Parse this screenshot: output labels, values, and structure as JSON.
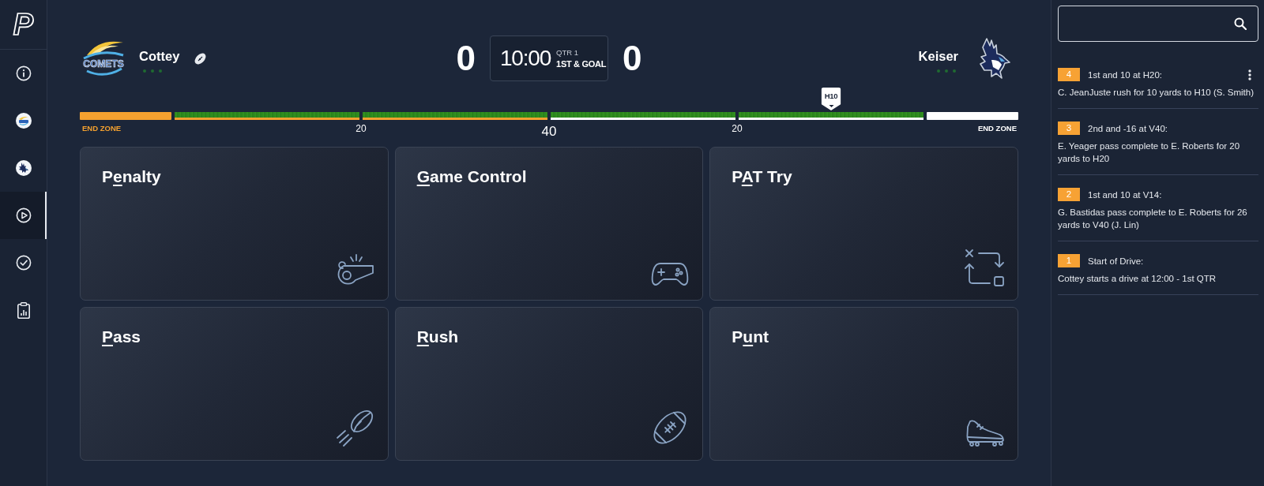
{
  "brand": {
    "logo": "P"
  },
  "sidebar": {
    "items": [
      {
        "selected": false
      },
      {
        "selected": false
      },
      {
        "selected": false
      },
      {
        "selected": true
      },
      {
        "selected": false
      },
      {
        "selected": false
      }
    ]
  },
  "scoreboard": {
    "home": {
      "name": "Cottey",
      "logo_text": "COMETS",
      "possession": true,
      "score": "0",
      "timeouts": [
        {
          "used": false
        },
        {
          "used": false
        },
        {
          "used": false
        }
      ]
    },
    "clock": {
      "time": "10:00",
      "period": "QTR 1",
      "down": "1ST & GOAL"
    },
    "away": {
      "name": "Keiser",
      "possession": false,
      "score": "0",
      "timeouts": [
        {
          "used": false
        },
        {
          "used": false
        },
        {
          "used": false
        }
      ]
    }
  },
  "field": {
    "segments": [
      {
        "kind": "end_zone",
        "color": "#f5a12f",
        "label": "END ZONE"
      },
      {
        "kind": "field",
        "color": "#f5a12f",
        "line_label": {
          "text": "20",
          "major": false
        }
      },
      {
        "kind": "field",
        "color": "#f5a12f",
        "line_label": {
          "text": "40",
          "major": true
        }
      },
      {
        "kind": "field",
        "color": "#ffffff",
        "line_label": {
          "text": "20",
          "major": false
        }
      },
      {
        "kind": "field",
        "color": "#ffffff",
        "marker": "H10"
      },
      {
        "kind": "end_zone",
        "color": "#ffffff",
        "label": "END ZONE"
      }
    ]
  },
  "play_buttons": [
    {
      "label_start": "P",
      "shortcut": "e",
      "label_end": "nalty"
    },
    {
      "shortcut": "G",
      "label_end": "ame Control"
    },
    {
      "label_start": "P",
      "shortcut": "A",
      "label_end": "T Try"
    },
    {
      "shortcut": "P",
      "label_end": "ass"
    },
    {
      "shortcut": "R",
      "label_end": "ush"
    },
    {
      "label_start": "P",
      "shortcut": "u",
      "label_end": "nt"
    }
  ],
  "plays": [
    {
      "number": "4",
      "title": "1st and 10 at H20:",
      "description": "C. JeanJuste rush for 10 yards to H10 (S. Smith)",
      "menu": true
    },
    {
      "number": "3",
      "title": "2nd and -16 at V40:",
      "description": "E. Yeager pass complete to E. Roberts for 20 yards to H20",
      "menu": false
    },
    {
      "number": "2",
      "title": "1st and 10 at V14:",
      "description": "G. Bastidas pass complete to E. Roberts for 26 yards to V40 (J. Lin)",
      "menu": false
    },
    {
      "number": "1",
      "title": "Start of Drive:",
      "description": "Cottey starts a drive at 12:00 - 1st QTR",
      "menu": false
    }
  ]
}
